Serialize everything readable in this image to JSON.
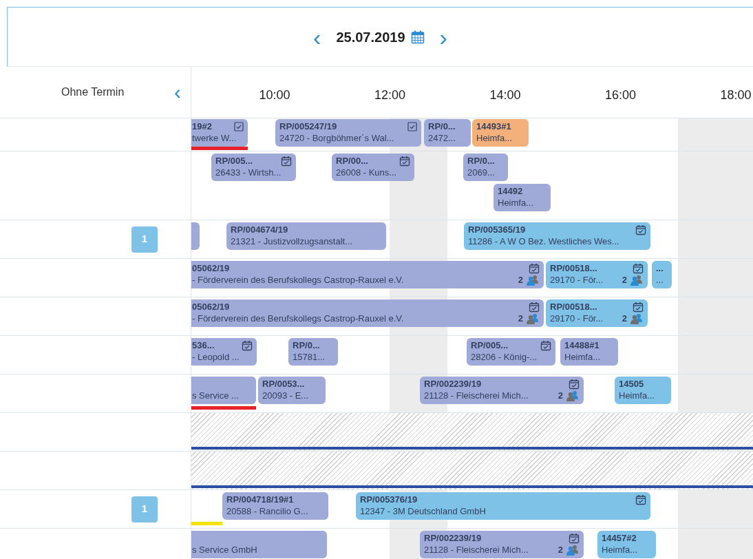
{
  "header": {
    "date": "25.07.2019",
    "prev": "‹",
    "next": "›"
  },
  "column_header": {
    "label": "Ohne Termin",
    "collapse": "‹",
    "hours": [
      "10:00",
      "12:00",
      "14:00",
      "16:00",
      "18:00"
    ]
  },
  "rows": [
    {
      "kind": "normal",
      "markers": [
        {
          "color": "#e8202a"
        }
      ],
      "lanes": [
        [
          {
            "kind": "checkbox",
            "color": "#a0aad8",
            "title": "19#2",
            "subtitle": "twerke W..."
          },
          {
            "kind": "checkbox",
            "color": "#a0aad8",
            "title": "RP/005247/19",
            "subtitle": "24720 - Borgböhmer´s Wal..."
          },
          {
            "kind": "plain",
            "color": "#a0aad8",
            "title": "RP/0...",
            "subtitle": "2472..."
          },
          {
            "kind": "plain",
            "color": "#f4b07a",
            "title": "14493#1",
            "subtitle": "Heimfa..."
          }
        ]
      ]
    },
    {
      "kind": "normal",
      "lanes": [
        [
          {
            "kind": "calendar",
            "color": "#a0aad8",
            "title": "RP/005...",
            "subtitle": "26433 - Wirtsh..."
          },
          {
            "kind": "calendar",
            "color": "#a0aad8",
            "title": "RP/00...",
            "subtitle": "26008 - Kuns..."
          },
          {
            "kind": "plain",
            "color": "#a0aad8",
            "title": "RP/0...",
            "subtitle": "2069..."
          }
        ],
        [
          {
            "kind": "plain",
            "color": "#a0aad8",
            "title": "14492",
            "subtitle": "Heimfa..."
          }
        ]
      ]
    },
    {
      "kind": "normal",
      "badge": "1",
      "lanes": [
        [
          {
            "kind": "plain",
            "color": "#a0aad8"
          },
          {
            "kind": "plain",
            "color": "#a0aad8",
            "title": "RP/004674/19",
            "subtitle": "21321 - Justizvollzugsanstalt..."
          },
          {
            "kind": "calendar",
            "color": "#7fc2e8",
            "title": "RP/005365/19",
            "subtitle": "11286 - A W O Bez. Westliches Wes..."
          }
        ]
      ]
    },
    {
      "kind": "normal",
      "lanes": [
        [
          {
            "kind": "calendar",
            "color": "#a0aad8",
            "title": "05062/19",
            "subtitle": "- Förderverein des Berufskollegs Castrop-Rauxel e.V.",
            "count": "2",
            "lead_highlighted": true
          },
          {
            "kind": "calendar",
            "color": "#7fc2e8",
            "title": "RP/00518...",
            "subtitle": "29170 - För...",
            "count": "2",
            "lead_highlighted": true
          },
          {
            "kind": "plain",
            "color": "#7fc2e8",
            "title": "...",
            "subtitle": "..."
          }
        ]
      ]
    },
    {
      "kind": "normal",
      "lanes": [
        [
          {
            "kind": "calendar",
            "color": "#a0aad8",
            "title": "05062/19",
            "subtitle": "- Förderverein des Berufskollegs Castrop-Rauxel e.V.",
            "count": "2",
            "lead_highlighted": false
          },
          {
            "kind": "calendar",
            "color": "#7fc2e8",
            "title": "RP/00518...",
            "subtitle": "29170 - För...",
            "count": "2",
            "lead_highlighted": false
          }
        ]
      ]
    },
    {
      "kind": "normal",
      "lanes": [
        [
          {
            "kind": "calendar",
            "color": "#a0aad8",
            "title": "536...",
            "subtitle": "- Leopold ..."
          },
          {
            "kind": "plain",
            "color": "#a0aad8",
            "title": "RP/0...",
            "subtitle": "15781..."
          },
          {
            "kind": "calendar",
            "color": "#a0aad8",
            "title": "RP/005...",
            "subtitle": "28206 - König-..."
          },
          {
            "kind": "plain",
            "color": "#a0aad8",
            "title": "14488#1",
            "subtitle": "Heimfa..."
          }
        ]
      ]
    },
    {
      "kind": "normal",
      "markers": [
        {
          "color": "#e8202a"
        }
      ],
      "lanes": [
        [
          {
            "kind": "plain",
            "color": "#a0aad8",
            "subtitle": "s Service ..."
          },
          {
            "kind": "plain",
            "color": "#a0aad8",
            "title": "RP/0053...",
            "subtitle": "20093 - E..."
          },
          {
            "kind": "calendar",
            "color": "#a0aad8",
            "title": "RP/002239/19",
            "subtitle": "21128 - Fleischerei Mich...",
            "count": "2",
            "lead_highlighted": false
          },
          {
            "kind": "plain",
            "color": "#7fc2e8",
            "title": "14505",
            "subtitle": "Heimfa..."
          }
        ]
      ]
    },
    {
      "kind": "blocked"
    },
    {
      "kind": "blocked"
    },
    {
      "kind": "normal",
      "badge": "1",
      "markers": [
        {
          "color": "#f5e20a"
        }
      ],
      "lanes": [
        [
          {
            "kind": "plain",
            "color": "#a0aad8",
            "title": "RP/004718/19#1",
            "subtitle": "20588 - Rancilio G..."
          },
          {
            "kind": "calendar",
            "color": "#7fc2e8",
            "title": "RP/005376/19",
            "subtitle": "12347 - 3M Deutschland GmbH"
          }
        ]
      ]
    },
    {
      "kind": "normal",
      "lanes": [
        [
          {
            "kind": "plain",
            "color": "#a0aad8",
            "subtitle": "s Service GmbH"
          },
          {
            "kind": "calendar",
            "color": "#a0aad8",
            "title": "RP/002239/19",
            "subtitle": "21128 - Fleischerei Mich...",
            "count": "2",
            "lead_highlighted": true
          },
          {
            "kind": "plain",
            "color": "#7fc2e8",
            "title": "14457#2",
            "subtitle": "Heimfa..."
          }
        ]
      ]
    }
  ]
}
